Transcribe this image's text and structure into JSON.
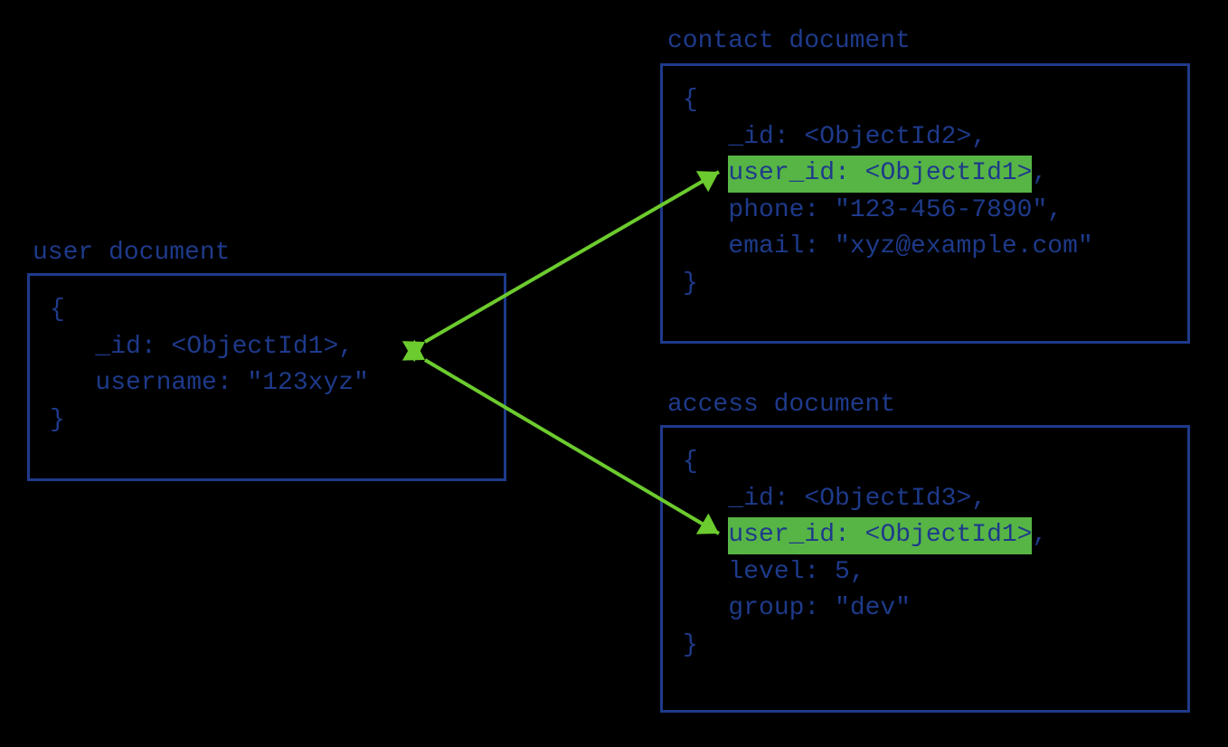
{
  "diagram": {
    "user": {
      "title": "user document",
      "open": "{",
      "id_line": "   _id: <ObjectId1>,",
      "username_line": "   username: \"123xyz\"",
      "close": "}"
    },
    "contact": {
      "title": "contact document",
      "open": "{",
      "id_line": "   _id: <ObjectId2>,",
      "userid_line": "   user_id: <ObjectId1>,",
      "phone_line": "   phone: \"123-456-7890\",",
      "email_line": "   email: \"xyz@example.com\"",
      "close": "}"
    },
    "access": {
      "title": "access document",
      "open": "{",
      "id_line": "   _id: <ObjectId3>,",
      "userid_line": "   user_id: <ObjectId1>,",
      "level_line": "   level: 5,",
      "group_line": "   group: \"dev\"",
      "close": "}"
    }
  },
  "colors": {
    "text": "#1E3A8A",
    "border": "#1E3A8A",
    "highlight_bg": "#57B545",
    "arrow": "#6CCB2E",
    "background": "#000000"
  }
}
